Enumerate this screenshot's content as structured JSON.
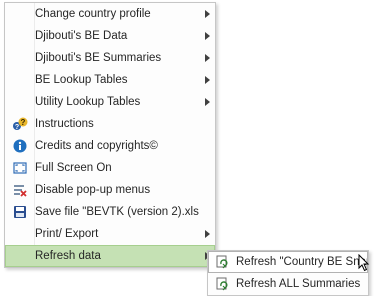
{
  "menu": {
    "items": [
      {
        "label": "Change country profile",
        "icon": "",
        "has_submenu": true
      },
      {
        "label": "Djibouti's BE Data",
        "icon": "",
        "has_submenu": true
      },
      {
        "label": "Djibouti's BE Summaries",
        "icon": "",
        "has_submenu": true
      },
      {
        "label": "BE Lookup Tables",
        "icon": "",
        "has_submenu": true
      },
      {
        "label": "Utility Lookup Tables",
        "icon": "",
        "has_submenu": true
      },
      {
        "label": "Instructions",
        "icon": "help-question-icon",
        "has_submenu": false
      },
      {
        "label": "Credits and copyrights©",
        "icon": "info-icon",
        "has_submenu": false
      },
      {
        "label": "Full Screen On",
        "icon": "full-screen-icon",
        "has_submenu": false
      },
      {
        "label": "Disable pop-up menus",
        "icon": "disable-menu-icon",
        "has_submenu": false
      },
      {
        "label": "Save file \"BEVTK (version 2).xlsm\"",
        "icon": "save-disk-icon",
        "has_submenu": false
      },
      {
        "label": "Print/ Export",
        "icon": "",
        "has_submenu": true
      },
      {
        "label": "Refresh data",
        "icon": "",
        "has_submenu": true,
        "highlighted": true
      }
    ]
  },
  "submenu": {
    "items": [
      {
        "label": "Refresh \"Country BE Snapshot\"",
        "icon": "refresh-icon",
        "highlighted": true
      },
      {
        "label": "Refresh ALL Summaries",
        "icon": "refresh-icon",
        "highlighted": false
      }
    ]
  },
  "colors": {
    "highlight": "#c5e1b4",
    "text": "#262626",
    "info_blue": "#1f6fbf",
    "save_blue": "#2a4d8f"
  }
}
